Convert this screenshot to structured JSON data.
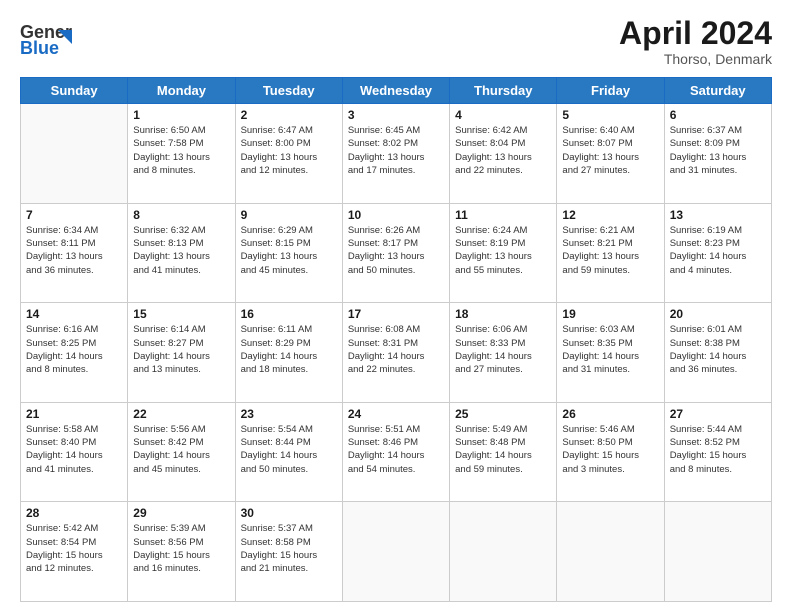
{
  "header": {
    "logo_general": "General",
    "logo_blue": "Blue",
    "month_title": "April 2024",
    "location": "Thorso, Denmark"
  },
  "weekdays": [
    "Sunday",
    "Monday",
    "Tuesday",
    "Wednesday",
    "Thursday",
    "Friday",
    "Saturday"
  ],
  "weeks": [
    [
      {
        "day": "",
        "info": ""
      },
      {
        "day": "1",
        "info": "Sunrise: 6:50 AM\nSunset: 7:58 PM\nDaylight: 13 hours\nand 8 minutes."
      },
      {
        "day": "2",
        "info": "Sunrise: 6:47 AM\nSunset: 8:00 PM\nDaylight: 13 hours\nand 12 minutes."
      },
      {
        "day": "3",
        "info": "Sunrise: 6:45 AM\nSunset: 8:02 PM\nDaylight: 13 hours\nand 17 minutes."
      },
      {
        "day": "4",
        "info": "Sunrise: 6:42 AM\nSunset: 8:04 PM\nDaylight: 13 hours\nand 22 minutes."
      },
      {
        "day": "5",
        "info": "Sunrise: 6:40 AM\nSunset: 8:07 PM\nDaylight: 13 hours\nand 27 minutes."
      },
      {
        "day": "6",
        "info": "Sunrise: 6:37 AM\nSunset: 8:09 PM\nDaylight: 13 hours\nand 31 minutes."
      }
    ],
    [
      {
        "day": "7",
        "info": "Sunrise: 6:34 AM\nSunset: 8:11 PM\nDaylight: 13 hours\nand 36 minutes."
      },
      {
        "day": "8",
        "info": "Sunrise: 6:32 AM\nSunset: 8:13 PM\nDaylight: 13 hours\nand 41 minutes."
      },
      {
        "day": "9",
        "info": "Sunrise: 6:29 AM\nSunset: 8:15 PM\nDaylight: 13 hours\nand 45 minutes."
      },
      {
        "day": "10",
        "info": "Sunrise: 6:26 AM\nSunset: 8:17 PM\nDaylight: 13 hours\nand 50 minutes."
      },
      {
        "day": "11",
        "info": "Sunrise: 6:24 AM\nSunset: 8:19 PM\nDaylight: 13 hours\nand 55 minutes."
      },
      {
        "day": "12",
        "info": "Sunrise: 6:21 AM\nSunset: 8:21 PM\nDaylight: 13 hours\nand 59 minutes."
      },
      {
        "day": "13",
        "info": "Sunrise: 6:19 AM\nSunset: 8:23 PM\nDaylight: 14 hours\nand 4 minutes."
      }
    ],
    [
      {
        "day": "14",
        "info": "Sunrise: 6:16 AM\nSunset: 8:25 PM\nDaylight: 14 hours\nand 8 minutes."
      },
      {
        "day": "15",
        "info": "Sunrise: 6:14 AM\nSunset: 8:27 PM\nDaylight: 14 hours\nand 13 minutes."
      },
      {
        "day": "16",
        "info": "Sunrise: 6:11 AM\nSunset: 8:29 PM\nDaylight: 14 hours\nand 18 minutes."
      },
      {
        "day": "17",
        "info": "Sunrise: 6:08 AM\nSunset: 8:31 PM\nDaylight: 14 hours\nand 22 minutes."
      },
      {
        "day": "18",
        "info": "Sunrise: 6:06 AM\nSunset: 8:33 PM\nDaylight: 14 hours\nand 27 minutes."
      },
      {
        "day": "19",
        "info": "Sunrise: 6:03 AM\nSunset: 8:35 PM\nDaylight: 14 hours\nand 31 minutes."
      },
      {
        "day": "20",
        "info": "Sunrise: 6:01 AM\nSunset: 8:38 PM\nDaylight: 14 hours\nand 36 minutes."
      }
    ],
    [
      {
        "day": "21",
        "info": "Sunrise: 5:58 AM\nSunset: 8:40 PM\nDaylight: 14 hours\nand 41 minutes."
      },
      {
        "day": "22",
        "info": "Sunrise: 5:56 AM\nSunset: 8:42 PM\nDaylight: 14 hours\nand 45 minutes."
      },
      {
        "day": "23",
        "info": "Sunrise: 5:54 AM\nSunset: 8:44 PM\nDaylight: 14 hours\nand 50 minutes."
      },
      {
        "day": "24",
        "info": "Sunrise: 5:51 AM\nSunset: 8:46 PM\nDaylight: 14 hours\nand 54 minutes."
      },
      {
        "day": "25",
        "info": "Sunrise: 5:49 AM\nSunset: 8:48 PM\nDaylight: 14 hours\nand 59 minutes."
      },
      {
        "day": "26",
        "info": "Sunrise: 5:46 AM\nSunset: 8:50 PM\nDaylight: 15 hours\nand 3 minutes."
      },
      {
        "day": "27",
        "info": "Sunrise: 5:44 AM\nSunset: 8:52 PM\nDaylight: 15 hours\nand 8 minutes."
      }
    ],
    [
      {
        "day": "28",
        "info": "Sunrise: 5:42 AM\nSunset: 8:54 PM\nDaylight: 15 hours\nand 12 minutes."
      },
      {
        "day": "29",
        "info": "Sunrise: 5:39 AM\nSunset: 8:56 PM\nDaylight: 15 hours\nand 16 minutes."
      },
      {
        "day": "30",
        "info": "Sunrise: 5:37 AM\nSunset: 8:58 PM\nDaylight: 15 hours\nand 21 minutes."
      },
      {
        "day": "",
        "info": ""
      },
      {
        "day": "",
        "info": ""
      },
      {
        "day": "",
        "info": ""
      },
      {
        "day": "",
        "info": ""
      }
    ]
  ]
}
